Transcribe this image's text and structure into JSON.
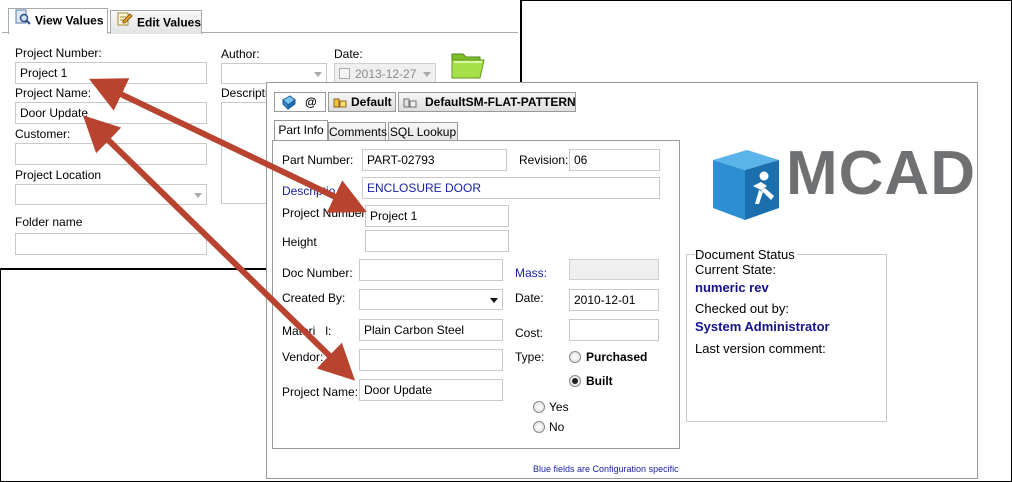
{
  "back_window": {
    "tabs": [
      "View Values",
      "Edit Values"
    ],
    "project_number_label": "Project Number:",
    "project_number_value": "Project 1",
    "project_name_label": "Project Name:",
    "project_name_value": "Door Update",
    "customer_label": "Customer:",
    "project_location_label": "Project Location",
    "folder_name_label": "Folder name",
    "author_label": "Author:",
    "date_label": "Date:",
    "date_value": "2013-12-27",
    "description_label": "Descriptio"
  },
  "front_window": {
    "config_tabs": [
      "@",
      "Default",
      "DefaultSM-FLAT-PATTERN"
    ],
    "sub_tabs": [
      "Part Info",
      "Comments",
      "SQL Lookup"
    ],
    "part_number_label": "Part Number:",
    "part_number_value": "PART-02793",
    "revision_label": "Revision:",
    "revision_value": "06",
    "description_label": "Descriptio",
    "description_value": "ENCLOSURE DOOR",
    "project_number_label": "Project Number:",
    "project_number_value": "Project 1",
    "height_label": "Height",
    "doc_number_label": "Doc Number:",
    "mass_label": "Mass:",
    "created_by_label": "Created By:",
    "date_label": "Date:",
    "date_value": "2010-12-01",
    "material_label": "Materi",
    "material_label_tail": "l:",
    "material_value": "Plain Carbon Steel",
    "cost_label": "Cost:",
    "vendor_label": "Vendor:",
    "type_label": "Type:",
    "type_options": [
      "Purchased",
      "Built"
    ],
    "type_selected": "Built",
    "project_name_label": "Project Name:",
    "project_name_value": "Door Update",
    "yes_no_options": [
      "Yes",
      "No"
    ],
    "footer_note": "Blue fields are Configuration specific"
  },
  "logo": {
    "text": "MCAD"
  },
  "document_status": {
    "legend": "Document Status",
    "current_state_label": "Current State:",
    "current_state_value": "numeric rev",
    "checked_out_label": "Checked out by:",
    "checked_out_value": "System Administrator",
    "last_comment_label": "Last version comment:"
  },
  "colors": {
    "arrow": "#b8432e",
    "config_blue": "#1a22a8",
    "status_value": "#12128a",
    "logo_cube": "#2b8fd1",
    "logo_text": "#6f7072"
  }
}
